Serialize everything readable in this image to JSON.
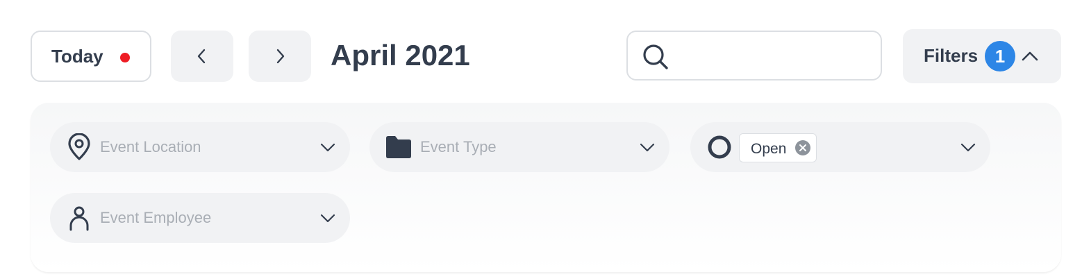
{
  "toolbar": {
    "today_label": "Today",
    "month_title": "April 2021",
    "search": {
      "value": "",
      "placeholder": ""
    },
    "filters_label": "Filters",
    "filters_count": "1"
  },
  "filters": {
    "location_placeholder": "Event Location",
    "type_placeholder": "Event Type",
    "status_tag": "Open",
    "employee_placeholder": "Event Employee"
  },
  "colors": {
    "text": "#333d4d",
    "today_dot": "#ee1c24",
    "badge": "#2d86e6",
    "pill_bg": "#f1f2f4",
    "placeholder": "#a9aeb5"
  },
  "icons": {
    "prev": "chevron-left-icon",
    "next": "chevron-right-icon",
    "search": "search-icon",
    "filters_toggle": "chevron-up-icon",
    "location": "map-pin-icon",
    "type": "folder-icon",
    "status": "circle-icon",
    "employee": "user-icon",
    "dropdown": "chevron-down-icon",
    "remove": "close-circle-icon"
  }
}
